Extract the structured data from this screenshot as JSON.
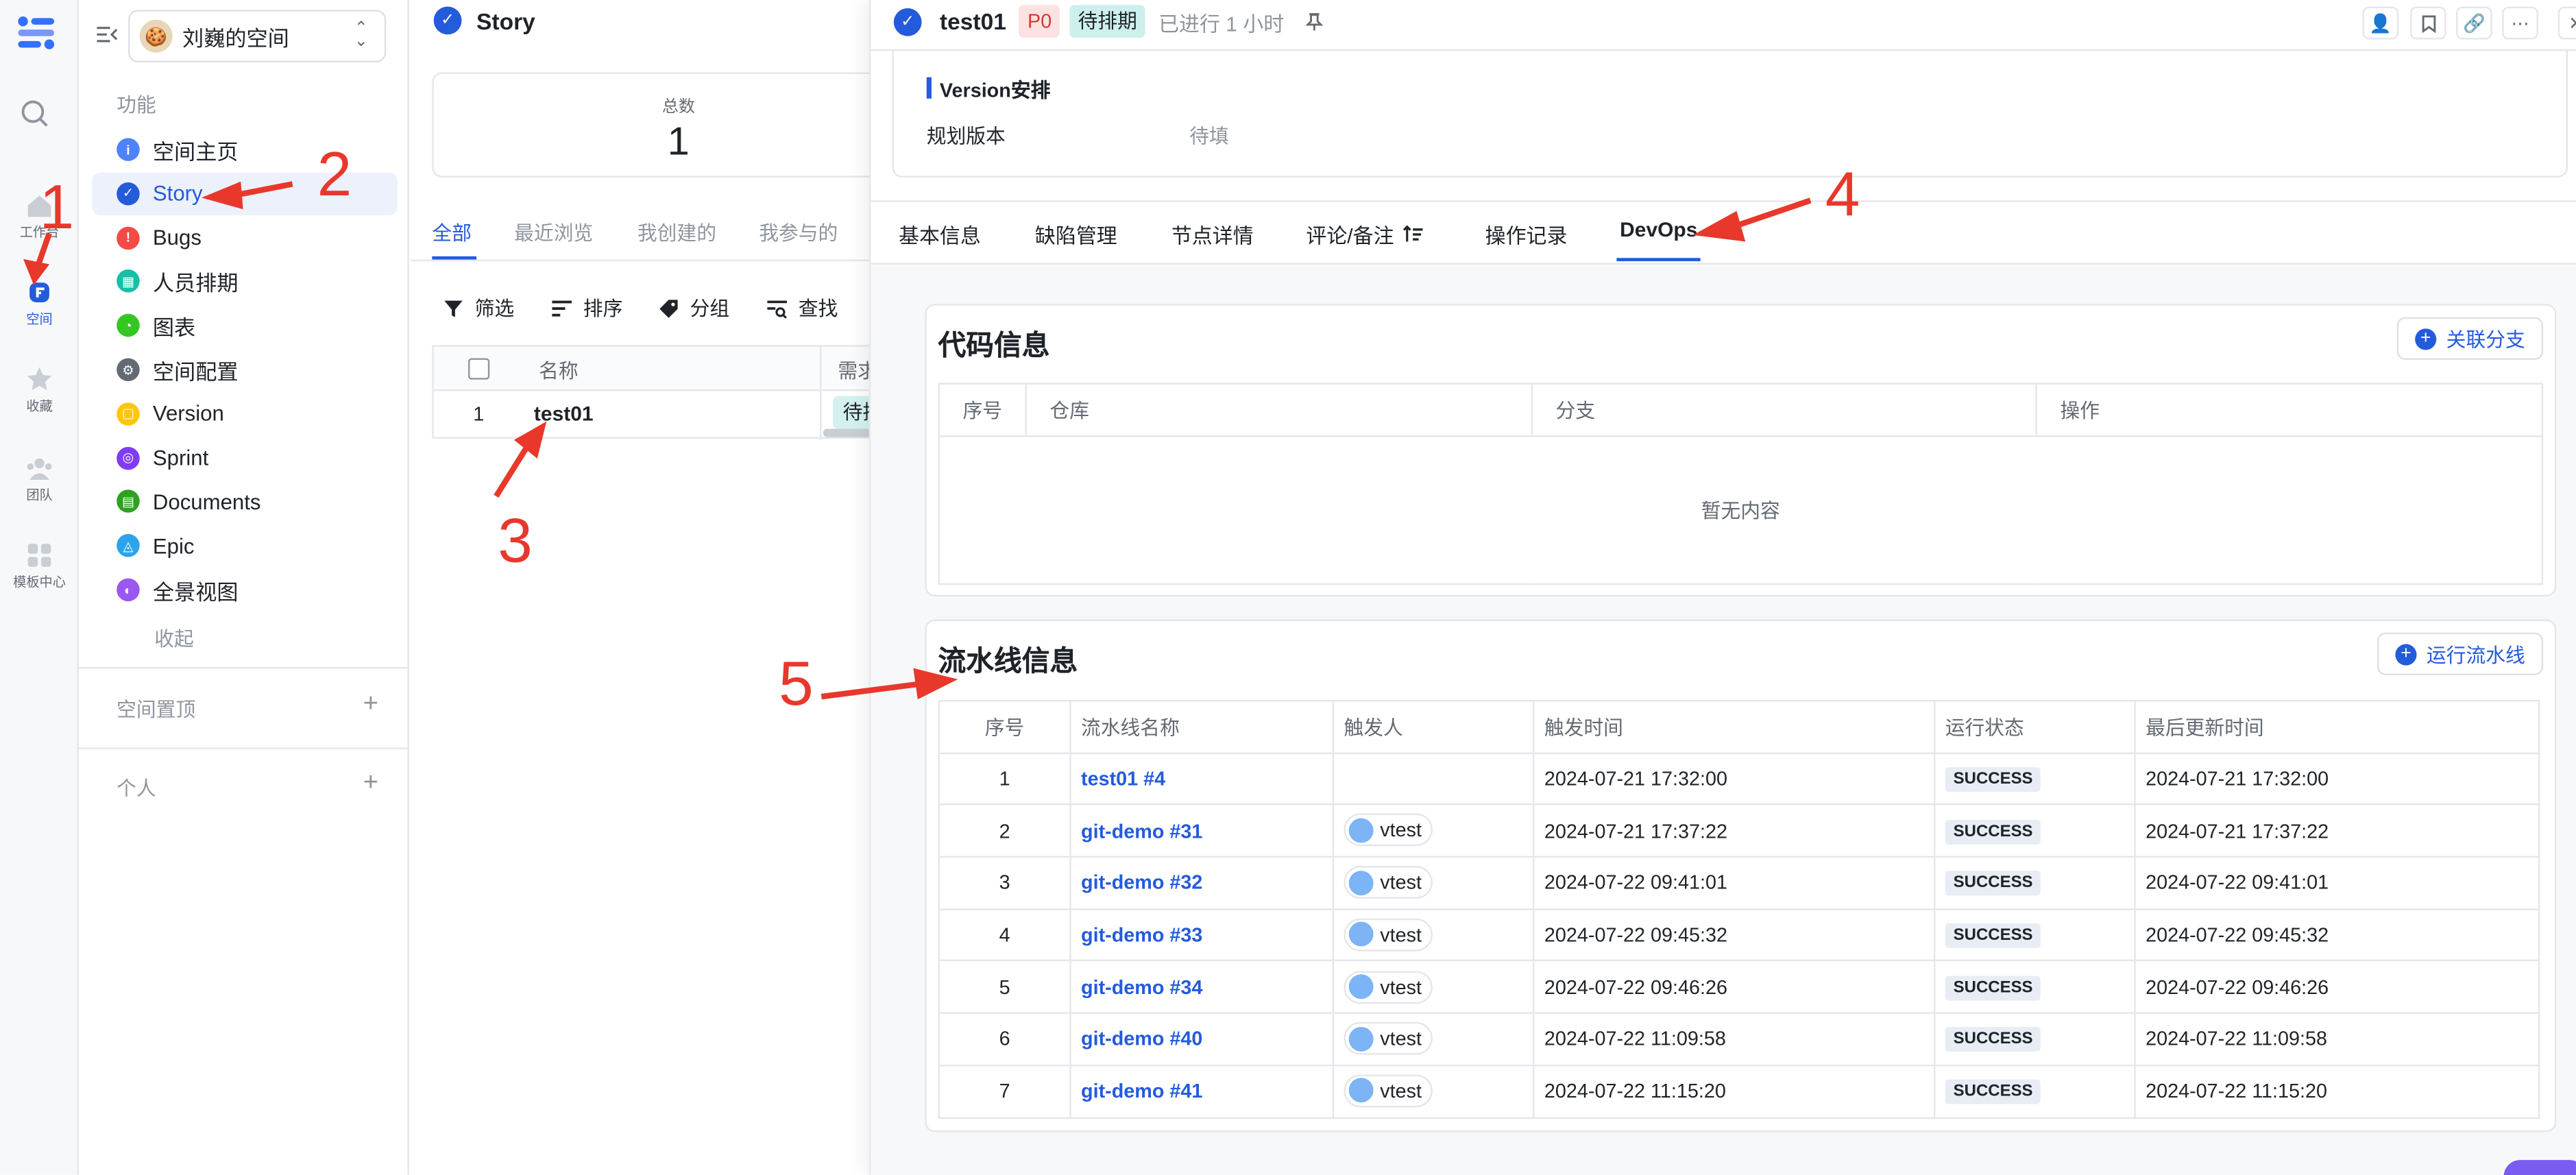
{
  "rail": {
    "items": [
      {
        "label": "工作台",
        "icon": "home-icon"
      },
      {
        "label": "空间",
        "icon": "space-icon",
        "active": true
      },
      {
        "label": "收藏",
        "icon": "star-icon"
      },
      {
        "label": "团队",
        "icon": "team-icon"
      },
      {
        "label": "模板中心",
        "icon": "template-icon"
      }
    ]
  },
  "sidebar": {
    "space_name": "刘巍的空间",
    "section_label": "功能",
    "items": [
      {
        "label": "空间主页",
        "color": "#4e83fd"
      },
      {
        "label": "Story",
        "color": "#245bdb"
      },
      {
        "label": "Bugs",
        "color": "#f54a45"
      },
      {
        "label": "人员排期",
        "color": "#14c0a6"
      },
      {
        "label": "图表",
        "color": "#34c724"
      },
      {
        "label": "空间配置",
        "color": "#646a73"
      },
      {
        "label": "Version",
        "color": "#ffc60a"
      },
      {
        "label": "Sprint",
        "color": "#7f3bf5"
      },
      {
        "label": "Documents",
        "color": "#2ea121"
      },
      {
        "label": "Epic",
        "color": "#2ca4eb"
      },
      {
        "label": "全景视图",
        "color": "#9a58f0"
      }
    ],
    "collapse": "收起",
    "pinned": "空间置顶",
    "personal": "个人"
  },
  "list": {
    "title": "Story",
    "total_label": "总数",
    "total_value": "1",
    "tabs": [
      "全部",
      "最近浏览",
      "我创建的",
      "我参与的"
    ],
    "toolbar": {
      "filter": "筛选",
      "sort": "排序",
      "group": "分组",
      "find": "查找"
    },
    "columns": [
      "名称",
      "需求"
    ],
    "row": {
      "index": "1",
      "name": "test01",
      "status": "待排期"
    }
  },
  "detail": {
    "title": "test01",
    "priority": "P0",
    "status": "待排期",
    "elapsed": "已进行 1 小时",
    "version_section": "Version安排",
    "plan_label": "规划版本",
    "plan_value": "待填",
    "tabs": [
      "基本信息",
      "缺陷管理",
      "节点详情",
      "评论/备注",
      "操作记录",
      "DevOps"
    ],
    "active_tab": "DevOps",
    "code": {
      "title": "代码信息",
      "button": "关联分支",
      "columns": [
        "序号",
        "仓库",
        "分支",
        "操作"
      ],
      "empty": "暂无内容"
    },
    "pipeline": {
      "title": "流水线信息",
      "button": "运行流水线",
      "columns": [
        "序号",
        "流水线名称",
        "触发人",
        "触发时间",
        "运行状态",
        "最后更新时间"
      ],
      "rows": [
        {
          "idx": "1",
          "name": "test01 #4",
          "user": "",
          "time": "2024-07-21 17:32:00",
          "status": "SUCCESS",
          "updated": "2024-07-21 17:32:00"
        },
        {
          "idx": "2",
          "name": "git-demo #31",
          "user": "vtest",
          "time": "2024-07-21 17:37:22",
          "status": "SUCCESS",
          "updated": "2024-07-21 17:37:22"
        },
        {
          "idx": "3",
          "name": "git-demo #32",
          "user": "vtest",
          "time": "2024-07-22 09:41:01",
          "status": "SUCCESS",
          "updated": "2024-07-22 09:41:01"
        },
        {
          "idx": "4",
          "name": "git-demo #33",
          "user": "vtest",
          "time": "2024-07-22 09:45:32",
          "status": "SUCCESS",
          "updated": "2024-07-22 09:45:32"
        },
        {
          "idx": "5",
          "name": "git-demo #34",
          "user": "vtest",
          "time": "2024-07-22 09:46:26",
          "status": "SUCCESS",
          "updated": "2024-07-22 09:46:26"
        },
        {
          "idx": "6",
          "name": "git-demo #40",
          "user": "vtest",
          "time": "2024-07-22 11:09:58",
          "status": "SUCCESS",
          "updated": "2024-07-22 11:09:58"
        },
        {
          "idx": "7",
          "name": "git-demo #41",
          "user": "vtest",
          "time": "2024-07-22 11:15:20",
          "status": "SUCCESS",
          "updated": "2024-07-22 11:15:20"
        }
      ]
    }
  },
  "annotations": [
    "1",
    "2",
    "3",
    "4",
    "5"
  ],
  "colors": {
    "accent": "#245bdb",
    "annotation": "#e8382c"
  }
}
